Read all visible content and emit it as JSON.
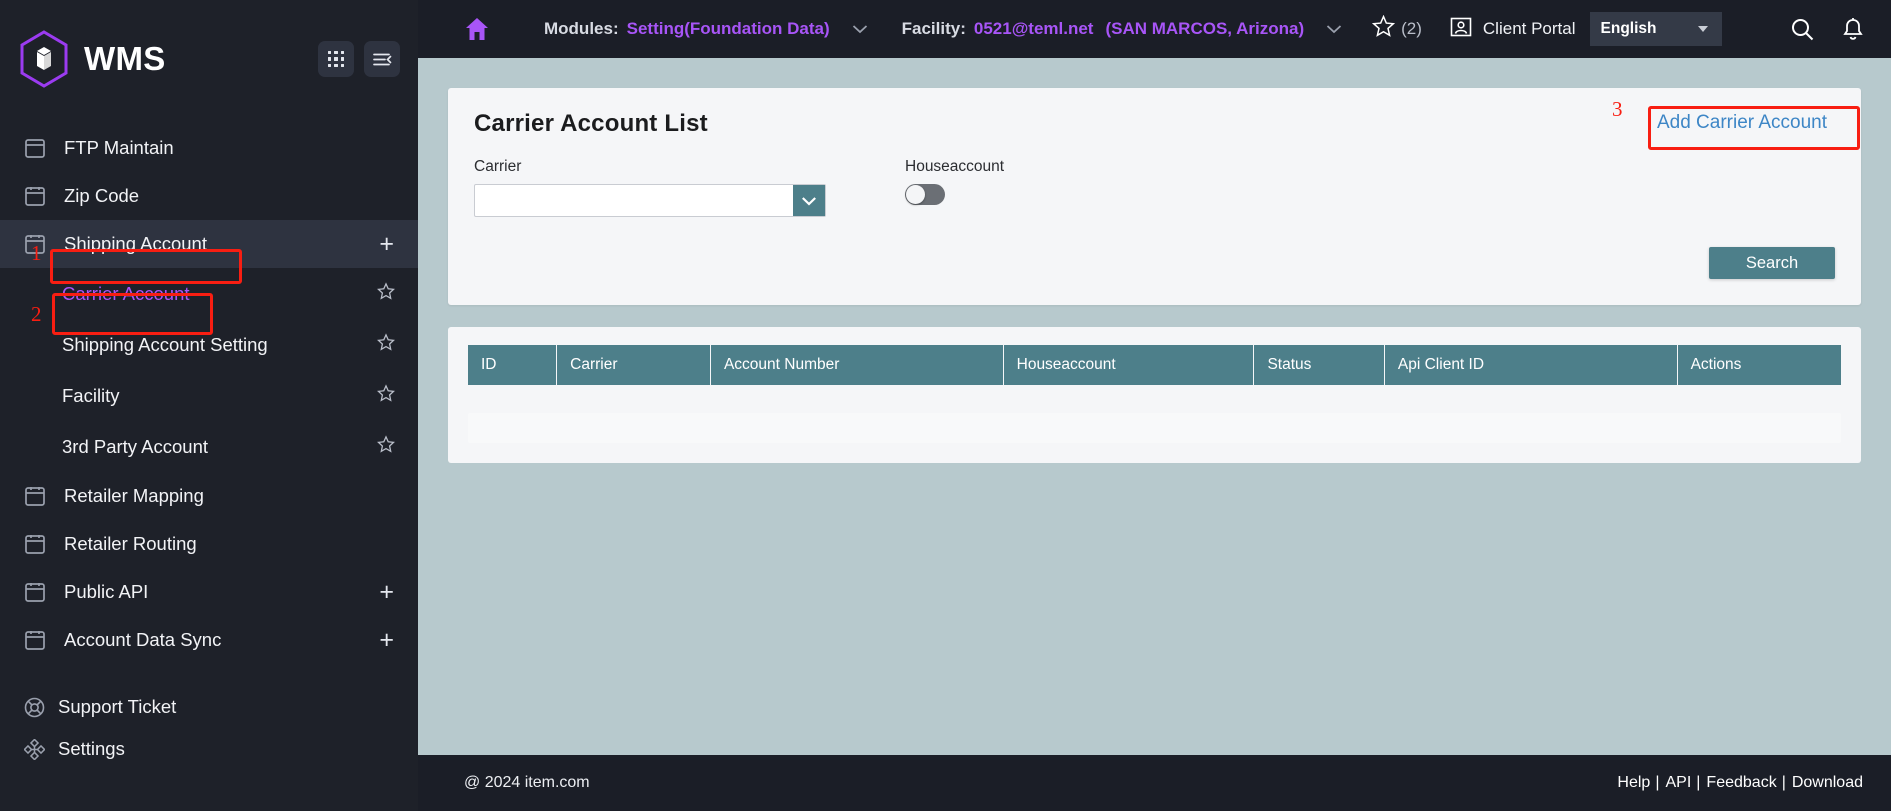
{
  "brand": {
    "name": "WMS",
    "logo_icon": "cube-hexagon-logo",
    "apps_icon": "apps-grid-icon",
    "collapse_icon": "collapse-sidebar-icon"
  },
  "sidebar": {
    "items": [
      {
        "label": "FTP Maintain",
        "icon": "folder-icon",
        "type": "top"
      },
      {
        "label": "Zip Code",
        "icon": "folder-icon",
        "type": "top"
      },
      {
        "label": "Shipping Account",
        "icon": "folder-icon",
        "type": "top",
        "active": true,
        "plus": "+"
      },
      {
        "label": "Carrier Account",
        "type": "sub",
        "current": true,
        "star": "star-icon"
      },
      {
        "label": "Shipping Account Setting",
        "type": "sub",
        "star": "star-icon"
      },
      {
        "label": "Facility",
        "type": "sub",
        "star": "star-icon"
      },
      {
        "label": "3rd Party Account",
        "type": "sub",
        "star": "star-icon"
      },
      {
        "label": "Retailer Mapping",
        "icon": "folder-icon",
        "type": "top"
      },
      {
        "label": "Retailer Routing",
        "icon": "folder-icon",
        "type": "top"
      },
      {
        "label": "Public API",
        "icon": "folder-icon",
        "type": "top",
        "plus": "+"
      },
      {
        "label": "Account Data Sync",
        "icon": "folder-icon",
        "type": "top",
        "plus": "+"
      }
    ],
    "bottom_items": [
      {
        "label": "Support Ticket",
        "icon": "lifebuoy-icon"
      },
      {
        "label": "Settings",
        "icon": "settings-nodes-icon"
      }
    ]
  },
  "topbar": {
    "home_icon": "home-icon",
    "modules_label": "Modules:",
    "modules_value": "Setting(Foundation Data)",
    "modules_caret_icon": "chevron-down-icon",
    "facility_label": "Facility:",
    "facility_value": "0521@teml.net",
    "facility_location": "(SAN MARCOS, Arizona)",
    "facility_caret_icon": "chevron-down-icon",
    "star_icon": "star-icon",
    "star_count": "(2)",
    "client_portal_icon": "user-card-icon",
    "client_portal_label": "Client Portal",
    "language_value": "English",
    "language_caret_icon": "caret-down-icon",
    "search_icon": "search-icon",
    "bell_icon": "notification-bell-icon"
  },
  "main": {
    "card_title": "Carrier Account List",
    "add_link": "Add Carrier Account",
    "filters": {
      "carrier_label": "Carrier",
      "carrier_value": "",
      "carrier_placeholder": "",
      "carrier_caret_icon": "chevron-down-icon",
      "houseaccount_label": "Houseaccount",
      "houseaccount_toggle": "off"
    },
    "search_button": "Search",
    "table": {
      "columns": [
        "ID",
        "Carrier",
        "Account Number",
        "Houseaccount",
        "Status",
        "Api Client ID",
        "Actions"
      ],
      "rows": []
    }
  },
  "footer": {
    "copyright": "@ 2024 item.com",
    "links": [
      "Help",
      "API",
      "Feedback",
      "Download"
    ],
    "separator": "|"
  },
  "annotations": [
    {
      "number": "1",
      "target": "shipping-account-nav-item"
    },
    {
      "number": "2",
      "target": "carrier-account-nav-item"
    },
    {
      "number": "3",
      "target": "add-carrier-account-link"
    }
  ],
  "colors": {
    "sidebar_bg": "#1e2129",
    "topbar_bg": "#1b1e27",
    "accent_purple": "#a855f7",
    "content_bg": "#b7c9cd",
    "teal": "#4d7f8a",
    "link_blue": "#3d86c6",
    "annotation_red": "#f81e12"
  }
}
